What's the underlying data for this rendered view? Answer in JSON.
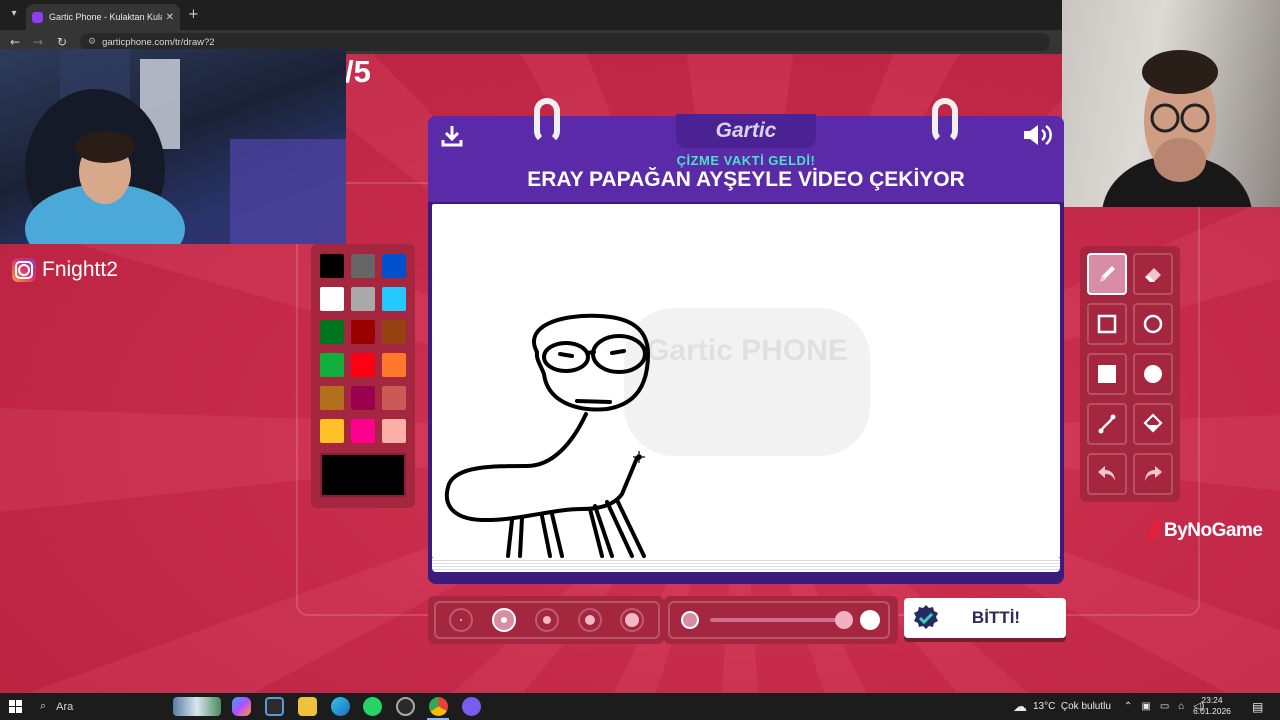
{
  "browser": {
    "tab_title": "Gartic Phone - Kulaktan Kulağa",
    "url": "garticphone.com/tr/draw?2"
  },
  "game": {
    "round_text": "/5",
    "logo": "Gartic",
    "prompt_subtitle": "ÇİZME VAKTİ GELDİ!",
    "prompt_title": "ERAY PAPAĞAN AYŞEYLE VİDEO ÇEKİYOR",
    "watermark_text": "Gartic PHONE",
    "done_label": "BİTTİ!",
    "palette_colors": [
      "#000000",
      "#666666",
      "#0050cd",
      "#ffffff",
      "#aaaaaa",
      "#26c9ff",
      "#017420",
      "#990000",
      "#964112",
      "#11b03c",
      "#ff0013",
      "#ff7829",
      "#b0701c",
      "#99004e",
      "#cb5a57",
      "#ffc126",
      "#ff008f",
      "#feafa8"
    ],
    "selected_color": "#000000",
    "tools": [
      "pencil",
      "eraser",
      "rectangle-outline",
      "ellipse-outline",
      "rectangle-filled",
      "ellipse-filled",
      "line",
      "fill-bucket",
      "undo",
      "redo"
    ],
    "active_tool": "pencil",
    "brush_size_selected_index": 1,
    "opacity_fraction": 1.0
  },
  "overlay": {
    "instagram_handle": "Fnightt2",
    "brand": "ByNoGame"
  },
  "taskbar": {
    "search_label": "Ara",
    "weather": "13°C  Çok bulutlu",
    "time": "23:24",
    "date": "6.01.2026"
  }
}
